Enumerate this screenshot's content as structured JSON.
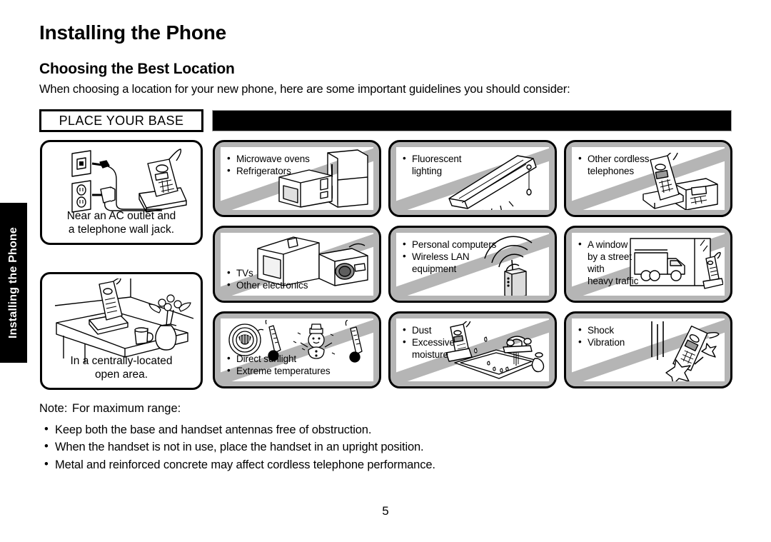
{
  "side_tab": {
    "label": "Installing the Phone"
  },
  "page_title": "Installing the Phone",
  "section_title": "Choosing the Best Location",
  "intro": "When choosing a location for your new phone, here are some important guidelines you should consider:",
  "band": {
    "place_base_label": "PLACE YOUR BASE",
    "bar_text": ""
  },
  "good_locations": [
    {
      "name": "near-ac-outlet",
      "caption_line1": "Near an AC outlet and",
      "caption_line2": "a telephone wall jack.",
      "art": "wall-jack-outlet-base"
    },
    {
      "name": "open-area",
      "caption_line1": "In a centrally-located",
      "caption_line2": "open area.",
      "art": "table-corner-handset"
    }
  ],
  "avoid_panels": [
    {
      "name": "microwave-refrigerator",
      "items": [
        "Microwave ovens",
        "Refrigerators"
      ],
      "text_pos": "tl",
      "art": "microwave-fridge"
    },
    {
      "name": "fluorescent-lighting",
      "items": [
        "Fluorescent",
        "lighting"
      ],
      "text_pos": "tl",
      "continuation": 1,
      "art": "fluorescent-lamp"
    },
    {
      "name": "other-cordless-telephones",
      "items": [
        "Other cordless",
        "telephones"
      ],
      "text_pos": "tl",
      "continuation": 1,
      "art": "cordless-phone-base"
    },
    {
      "name": "tvs-other-electronics",
      "items": [
        "TVs",
        "Other electronics"
      ],
      "text_pos": "bl",
      "art": "tv-radio"
    },
    {
      "name": "computers-wireless-lan",
      "items": [
        "Personal computers",
        "Wireless LAN",
        "equipment"
      ],
      "text_pos": "tl",
      "continuation": 2,
      "art": "wifi-router"
    },
    {
      "name": "window-heavy-traffic",
      "items": [
        "A window",
        "by a street",
        "with",
        "heavy traffic"
      ],
      "text_pos": "tl",
      "continuation": 1,
      "art": "window-truck"
    },
    {
      "name": "sunlight-temperature",
      "items": [
        "Direct sunlight",
        "Extreme temperatures"
      ],
      "text_pos": "bl",
      "art": "sun-snowman-thermometer"
    },
    {
      "name": "dust-moisture",
      "items": [
        "Dust",
        "Excessive",
        "moisture"
      ],
      "text_pos": "tl",
      "continuation": 2,
      "art": "sink-faucet-handset"
    },
    {
      "name": "shock-vibration",
      "items": [
        "Shock",
        "Vibration"
      ],
      "text_pos": "tl",
      "art": "dropped-handset"
    }
  ],
  "note": {
    "label": "Note:",
    "heading": "For maximum range:",
    "bullets": [
      "Keep both the base and handset antennas free of obstruction.",
      "When the handset is not in use, place the handset in an upright position.",
      "Metal and reinforced concrete may affect cordless telephone performance."
    ]
  },
  "page_number": "5"
}
